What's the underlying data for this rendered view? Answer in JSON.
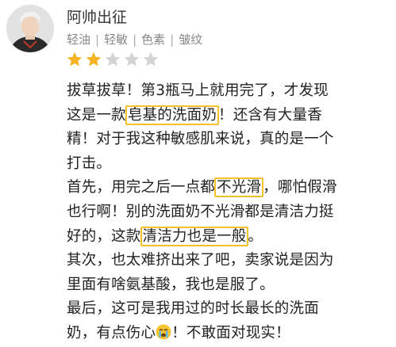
{
  "user": {
    "name": "阿帅出征",
    "tags": [
      "轻油",
      "轻敏",
      "色素",
      "皱纹"
    ]
  },
  "rating": {
    "value": 2,
    "max": 5,
    "filled_color": "#f5b325",
    "empty_color": "#d3d3d3"
  },
  "highlight_color": "#f2c22b",
  "review": {
    "lines": [
      [
        {
          "t": "拔草拔草！第3瓶马上就用完了，才发现"
        }
      ],
      [
        {
          "t": "这是一款"
        },
        {
          "t": "皂基的洗面奶",
          "hl": true
        },
        {
          "t": "！还含有大量香"
        }
      ],
      [
        {
          "t": "精！对于我这种敏感肌来说，真的是一个"
        }
      ],
      [
        {
          "t": "打击。"
        }
      ],
      [
        {
          "t": "首先，用完之后一点都"
        },
        {
          "t": "不光滑",
          "hl": true
        },
        {
          "t": "，哪怕假滑"
        }
      ],
      [
        {
          "t": "也行啊！别的洗面奶不光滑都是清洁力挺"
        }
      ],
      [
        {
          "t": "好的，这款"
        },
        {
          "t": "清洁力也是一般",
          "hl": true
        },
        {
          "t": "。"
        }
      ],
      [
        {
          "t": "其次，也太难挤出来了吧，卖家说是因为"
        }
      ],
      [
        {
          "t": "里面有啥氨基酸，我也是服了。"
        }
      ],
      [
        {
          "t": "最后，这可是我用过的时长最长的洗面"
        }
      ],
      [
        {
          "t": "奶，有点伤心"
        },
        {
          "emoji": "crying-face"
        },
        {
          "t": "！不敢面对现实！"
        }
      ]
    ]
  }
}
